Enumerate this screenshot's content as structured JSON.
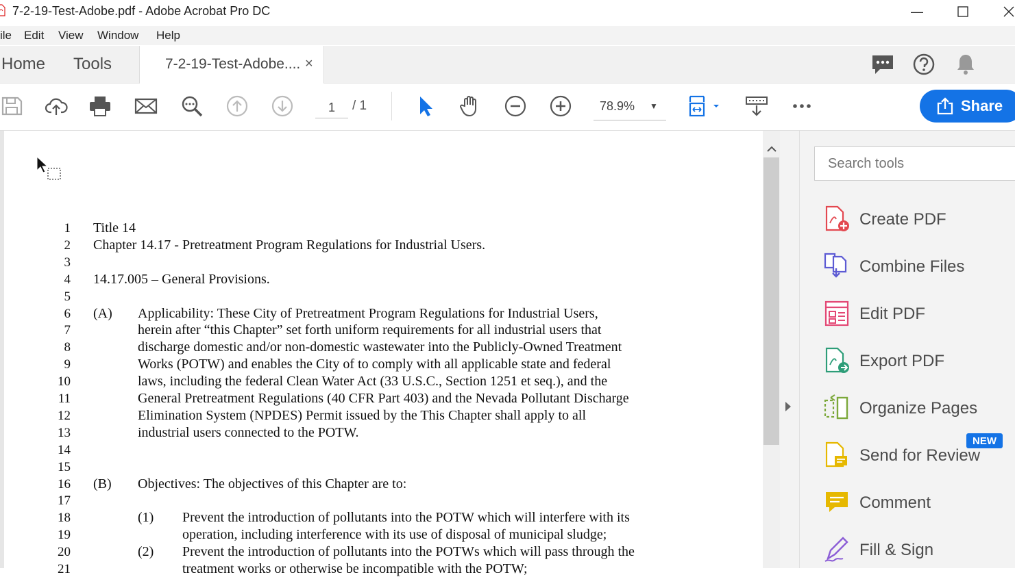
{
  "window": {
    "title": "7-2-19-Test-Adobe.pdf - Adobe Acrobat Pro DC",
    "minimize": "—",
    "maximize": "☐",
    "close": "✕"
  },
  "menu": [
    "ile",
    "Edit",
    "View",
    "Window",
    "Help"
  ],
  "tabs": {
    "home": "Home",
    "tools": "Tools",
    "document": "7-2-19-Test-Adobe....",
    "close": "×"
  },
  "toolbar": {
    "page_current": "1",
    "page_total": "/ 1",
    "zoom": "78.9%",
    "share": "Share",
    "icons": [
      "save-icon",
      "cloud-upload-icon",
      "print-icon",
      "email-icon",
      "find-icon",
      "page-up-icon",
      "page-down-icon",
      "select-arrow-icon",
      "hand-icon",
      "zoom-out-icon",
      "zoom-in-icon",
      "fit-page-icon",
      "keyboard-scroll-icon",
      "more-icon"
    ]
  },
  "document": {
    "lines": [
      {
        "n": "1",
        "tag": "",
        "text": "Title 14"
      },
      {
        "n": "2",
        "tag": "",
        "text": "Chapter 14.17 - Pretreatment Program Regulations for Industrial Users."
      },
      {
        "n": "3",
        "tag": "",
        "text": ""
      },
      {
        "n": "4",
        "tag": "",
        "text": "14.17.005 – General Provisions."
      },
      {
        "n": "5",
        "tag": "",
        "text": ""
      },
      {
        "n": "6",
        "tag": "(A)",
        "text": "Applicability:  These City of Pretreatment Program Regulations for Industrial Users,"
      },
      {
        "n": "7",
        "tag": "",
        "text": "herein after “this Chapter” set forth uniform requirements for all industrial users that"
      },
      {
        "n": "8",
        "tag": "",
        "text": "discharge domestic and/or non-domestic wastewater into the Publicly-Owned Treatment"
      },
      {
        "n": "9",
        "tag": "",
        "text": "Works (POTW) and enables the City of to comply with all applicable state and federal"
      },
      {
        "n": "10",
        "tag": "",
        "text": "laws, including the federal Clean Water Act (33 U.S.C., Section 1251 et seq.), and the"
      },
      {
        "n": "11",
        "tag": "",
        "text": "General Pretreatment Regulations (40 CFR Part 403) and the Nevada Pollutant Discharge"
      },
      {
        "n": "12",
        "tag": "",
        "text": "Elimination System (NPDES) Permit issued by the This Chapter shall apply to all"
      },
      {
        "n": "13",
        "tag": "",
        "text": "industrial users connected to the POTW."
      },
      {
        "n": "14",
        "tag": "",
        "text": ""
      },
      {
        "n": "15",
        "tag": "",
        "text": ""
      },
      {
        "n": "16",
        "tag": "(B)",
        "text": "Objectives:  The objectives of this Chapter are to:"
      },
      {
        "n": "17",
        "tag": "",
        "text": ""
      },
      {
        "n": "18",
        "tag": "(1)",
        "text": "Prevent the introduction of pollutants into the POTW which will interfere with its"
      },
      {
        "n": "19",
        "tag": "",
        "text": "operation, including interference with its use of disposal of municipal sludge;"
      },
      {
        "n": "20",
        "tag": "(2)",
        "text": "Prevent the introduction of pollutants into the POTWs which will pass through the"
      },
      {
        "n": "21",
        "tag": "",
        "text": "treatment works or otherwise be incompatible with the POTW;"
      }
    ]
  },
  "tools_pane": {
    "search_placeholder": "Search tools",
    "new_badge": "NEW",
    "items": [
      {
        "label": "Create PDF",
        "icon": "create-pdf-icon",
        "color": "#e34850"
      },
      {
        "label": "Combine Files",
        "icon": "combine-files-icon",
        "color": "#5d5bd4"
      },
      {
        "label": "Edit PDF",
        "icon": "edit-pdf-icon",
        "color": "#e34875"
      },
      {
        "label": "Export PDF",
        "icon": "export-pdf-icon",
        "color": "#2d9d78"
      },
      {
        "label": "Organize Pages",
        "icon": "organize-pages-icon",
        "color": "#7ca83a"
      },
      {
        "label": "Send for Review",
        "icon": "send-for-review-icon",
        "color": "#e6b800"
      },
      {
        "label": "Comment",
        "icon": "comment-icon",
        "color": "#e6b800"
      },
      {
        "label": "Fill & Sign",
        "icon": "fill-sign-icon",
        "color": "#8b5cd6"
      }
    ]
  },
  "colors": {
    "accent": "#1473e6",
    "select_tool": "#1473e6"
  }
}
